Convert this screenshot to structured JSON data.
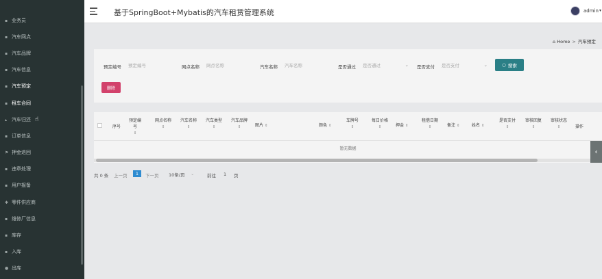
{
  "sidebar": {
    "items": [
      {
        "label": "业务员",
        "icon": "grid-icon"
      },
      {
        "label": "汽车网点",
        "icon": "grid-icon"
      },
      {
        "label": "汽车品牌",
        "icon": "grid-icon"
      },
      {
        "label": "汽车信息",
        "icon": "grid-icon"
      },
      {
        "label": "汽车预定",
        "icon": "grid-icon"
      },
      {
        "label": "租车合同",
        "icon": "grid-icon"
      },
      {
        "label": "汽车归还",
        "icon": "car-icon"
      },
      {
        "label": "订单信息",
        "icon": "grid-icon"
      },
      {
        "label": "押金退回",
        "icon": "flag-icon"
      },
      {
        "label": "违章处理",
        "icon": "grid-icon"
      },
      {
        "label": "用户报备",
        "icon": "grid-icon"
      },
      {
        "label": "零件供应商",
        "icon": "gear-icon"
      },
      {
        "label": "维修厂信息",
        "icon": "grid-icon"
      },
      {
        "label": "库存",
        "icon": "grid-icon"
      },
      {
        "label": "入库",
        "icon": "grid-icon"
      },
      {
        "label": "出库",
        "icon": "pin-icon"
      }
    ]
  },
  "header": {
    "title": "基于SpringBoot+Mybatis的汽车租赁管理系统",
    "user": "admin"
  },
  "breadcrumb": {
    "home": "Home",
    "current": "汽车预定"
  },
  "search": {
    "fields": [
      {
        "label": "预定编号",
        "placeholder": "预定编号"
      },
      {
        "label": "网点名称",
        "placeholder": "网点名称"
      },
      {
        "label": "汽车名称",
        "placeholder": "汽车名称"
      }
    ],
    "selects": [
      {
        "label": "是否通过",
        "value": "是否通过"
      },
      {
        "label": "是否支付",
        "value": "是否支付"
      }
    ],
    "search_button": "搜索",
    "delete_button": "删除"
  },
  "table": {
    "columns": [
      "序号",
      "预定编号",
      "网点名称",
      "汽车名称",
      "汽车类型",
      "汽车品牌",
      "图片",
      "颜色",
      "车牌号",
      "每日价格",
      "押金",
      "租借日期",
      "备注",
      "姓名",
      "是否支付",
      "审核回复",
      "审核状态",
      "操作"
    ],
    "empty_text": "暂无数据"
  },
  "pagination": {
    "total": "共 0 条",
    "prev": "上一页",
    "current": "1",
    "next": "下一页",
    "page_size": "10条/页",
    "goto_label": "前往",
    "goto_value": "1",
    "page_suffix": "页"
  },
  "colors": {
    "sidebar_bg": "#283333",
    "search_button": "#2a7f86",
    "delete_button": "#d2416b",
    "page_active": "#2e8bd0"
  }
}
